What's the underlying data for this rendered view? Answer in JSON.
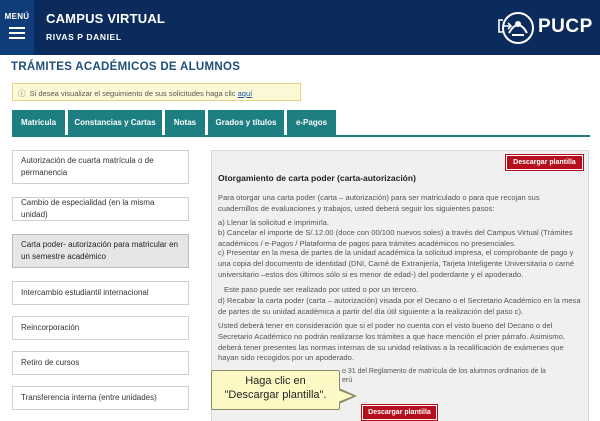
{
  "header": {
    "menu_label": "MENÚ",
    "app_title": "CAMPUS VIRTUAL",
    "user_name": "RIVAS P DANIEL",
    "brand": "PUCP"
  },
  "page": {
    "title": "TRÁMITES ACADÉMICOS DE ALUMNOS",
    "info_text": "Si desea visualizar el seguimiento de sus solicitudes haga clic",
    "info_link": "aquí"
  },
  "tabs": [
    {
      "label": "Matrícula"
    },
    {
      "label": "Constancias y Cartas"
    },
    {
      "label": "Notas"
    },
    {
      "label": "Grados y títulos"
    },
    {
      "label": "e-Pagos"
    }
  ],
  "left_menu": [
    {
      "label": "Autorización de cuarta matrícula o de permanencia"
    },
    {
      "label": "Cambio de especialidad (en la misma unidad)"
    },
    {
      "label": "Carta poder- autorización para matricular en un semestre académico"
    },
    {
      "label": "Intercambio estudiantil internacional"
    },
    {
      "label": "Reincorporación"
    },
    {
      "label": "Retiro de cursos"
    },
    {
      "label": "Transferencia interna (entre unidades)"
    }
  ],
  "panel": {
    "download_label": "Descargar plantilla",
    "title": "Otorgamiento de carta poder (carta-autorización)",
    "intro": "Para otorgar una carta poder (carta – autorización) para ser matriculado o para que recojan sus cuadernillos de evaluaciones y trabajos, usted deberá seguir los siguientes pasos:",
    "step_a": "a) Llenar la solicitud e imprimirla.",
    "step_b": "b) Cancelar el importe de S/.12.00 (doce con 00/100 nuevos soles) a través del Campus Virtual (Trámites académicos / e-Pagos / Plataforma de pagos para trámites académicos no presenciales.",
    "step_c": "c) Presentar en la mesa de partes de la unidad académica la solicitud impresa, el comprobante de pago y una copia del documento de identidad (DNI, Carné de Extranjería, Tarjeta Inteligente Universitaria o carné universitario –estos dos últimos sólo si es menor de edad-) del poderdante y el apoderado.",
    "step_c_note": "Este paso puede ser realizado por usted o por un tercero.",
    "step_d": "d) Recabar la carta poder (carta – autorización) visada por el Decano o el Secretario Académico en la mesa de partes de su unidad académica a partir del día útil siguiente a la realización del paso c).",
    "note": "Usted deberá tener en consideración que si el poder no cuenta con el visto bueno del Decano o del Secretario Académico no podrán realizarse los trámites a que hace mención el prier párrafo. Asimismo, deberá tener presentes las normas internas de su unidad relativas a la recalificación de exámenes que hayan sido recogidos por un apoderado.",
    "footer_a": "o 31 del Reglamento de matrícula de los alumnos ordinarios de la",
    "footer_b": "erú"
  },
  "callout": {
    "line1": "Haga clic en",
    "line2": "\"Descargar plantilla\"."
  },
  "colors": {
    "header_bg": "#0a2b5c",
    "tab_bg": "#1e7f82",
    "download_red": "#b50e1c",
    "callout_bg": "#fdf9c4"
  }
}
